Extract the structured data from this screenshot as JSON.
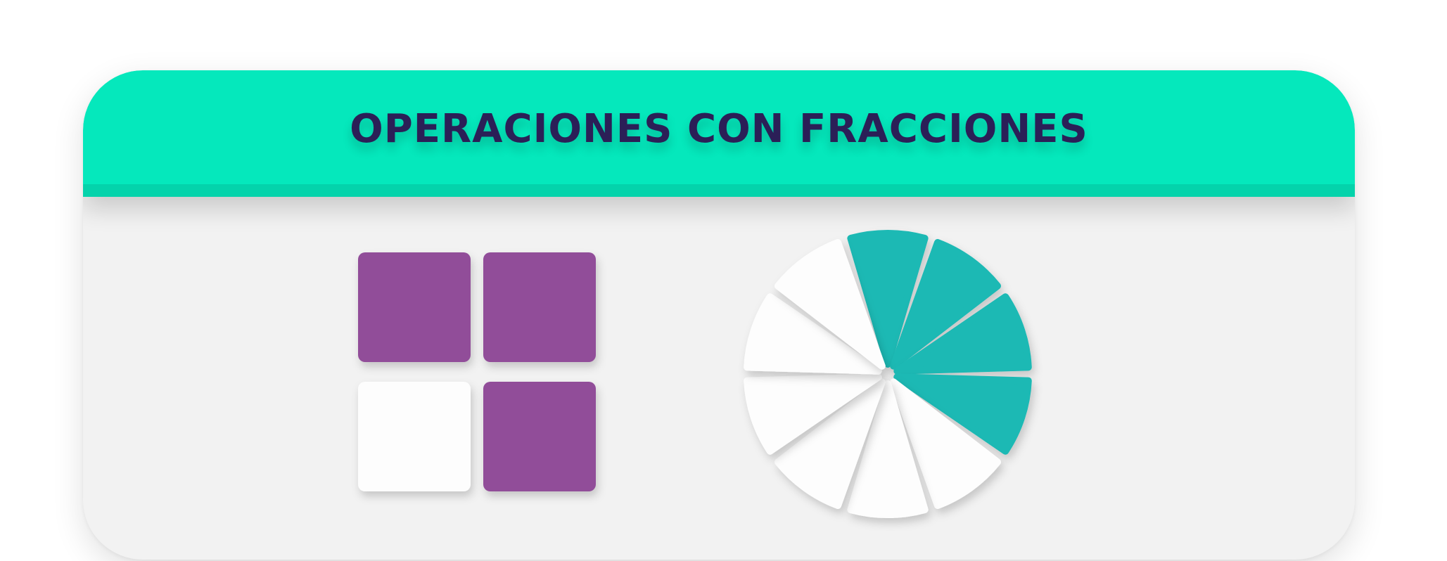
{
  "title": "OPERACIONES CON FRACCIONES",
  "colors": {
    "header": "#05e8bc",
    "header_stripe": "#04d3ab",
    "title_text": "#2b1f57",
    "card_body": "#f2f2f2",
    "square_filled": "#914d99",
    "slice_filled": "#1cb9b4",
    "empty_piece": "#fdfdfd"
  },
  "square_fraction": {
    "total_parts": 4,
    "filled_parts": 3,
    "cells": [
      {
        "filled": true
      },
      {
        "filled": true
      },
      {
        "filled": false
      },
      {
        "filled": true
      }
    ]
  },
  "circle_fraction": {
    "total_parts": 10,
    "filled_parts": 4
  }
}
